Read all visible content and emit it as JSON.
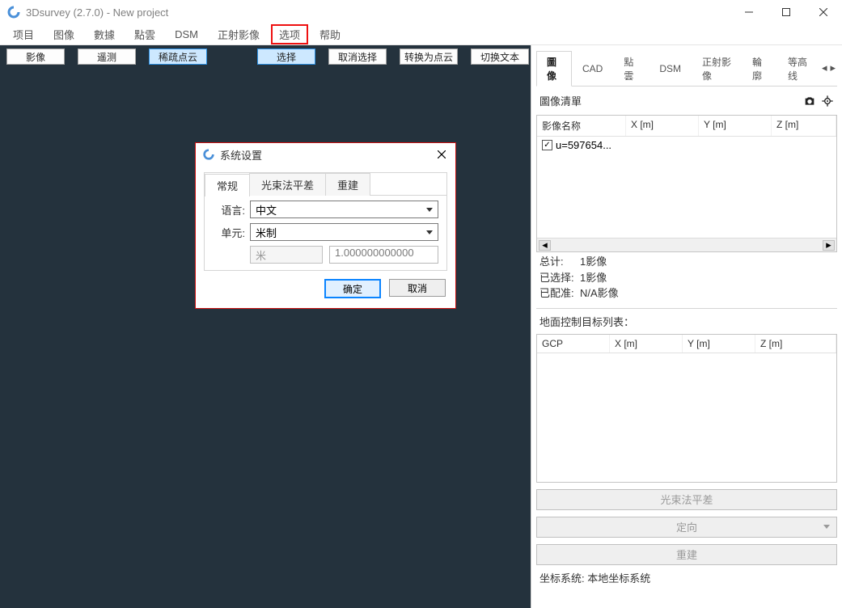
{
  "window": {
    "title": "3Dsurvey (2.7.0) - New project",
    "controls": {
      "min": "_",
      "max": "□",
      "close": "✕"
    }
  },
  "menu": {
    "items": [
      "项目",
      "图像",
      "數據",
      "點雲",
      "DSM",
      "正射影像",
      "选项",
      "帮助"
    ],
    "highlighted_index": 6
  },
  "toolbar": {
    "buttons": [
      "影像",
      "遥测",
      "稀疏点云",
      "",
      "选择",
      "取消选择",
      "转换为点云",
      "切换文本"
    ],
    "active_index": 4
  },
  "dialog": {
    "title": "系统设置",
    "tabs": [
      "常规",
      "光束法平差",
      "重建"
    ],
    "active_tab": 0,
    "language_label": "语言:",
    "language_value": "中文",
    "units_label": "单元:",
    "units_value": "米制",
    "unit_sub_value": "米",
    "unit_numeric": "1.000000000000",
    "ok": "确定",
    "cancel": "取消"
  },
  "side": {
    "tabs": [
      "圖像",
      "CAD",
      "點雲",
      "DSM",
      "正射影像",
      "輪廓",
      "等高线"
    ],
    "active_tab": 0,
    "heading": "圖像清單",
    "image_table": {
      "headers": [
        "影像名称",
        "X [m]",
        "Y [m]",
        "Z [m]"
      ],
      "rows": [
        {
          "checked": true,
          "name": "u=597654...",
          "x": "",
          "y": "",
          "z": ""
        }
      ]
    },
    "stats": {
      "total_label": "总计:",
      "total_value": "1影像",
      "selected_label": "已选择:",
      "selected_value": "1影像",
      "aligned_label": "已配准:",
      "aligned_value": "N/A影像"
    },
    "gcp_label": "地面控制目标列表：",
    "gcp_table": {
      "headers": [
        "GCP",
        "X [m]",
        "Y [m]",
        "Z [m]"
      ]
    },
    "buttons": {
      "bundle": "光束法平差",
      "orient": "定向",
      "reconstruct": "重建"
    },
    "coord_label": "坐标系统:",
    "coord_value": "本地坐标系统"
  }
}
